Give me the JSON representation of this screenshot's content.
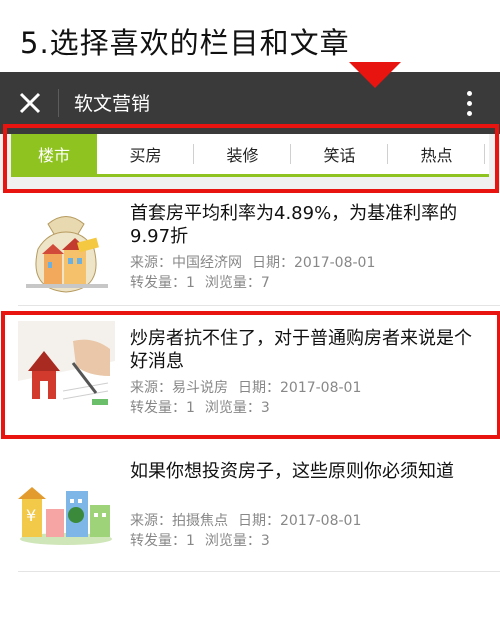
{
  "banner": {
    "title": "5.选择喜欢的栏目和文章"
  },
  "app": {
    "title": "软文营销"
  },
  "tabs": [
    {
      "label": "楼市",
      "active": true
    },
    {
      "label": "买房",
      "active": false
    },
    {
      "label": "装修",
      "active": false
    },
    {
      "label": "笑话",
      "active": false
    },
    {
      "label": "热点",
      "active": false
    }
  ],
  "articles": [
    {
      "title": "首套房平均利率为4.89%，为基准利率的9.97折",
      "source_label": "来源：中国经济网",
      "date_label": "日期：2017-08-01",
      "shares_label": "转发量：1",
      "views_label": "浏览量：7"
    },
    {
      "title": "炒房者抗不住了，对于普通购房者来说是个好消息",
      "source_label": "来源：易斗说房",
      "date_label": "日期：2017-08-01",
      "shares_label": "转发量：1",
      "views_label": "浏览量：3"
    },
    {
      "title": "如果你想投资房子，这些原则你必须知道",
      "source_label": "来源：拍摄焦点",
      "date_label": "日期：2017-08-01",
      "shares_label": "转发量：1",
      "views_label": "浏览量：3"
    }
  ],
  "colors": {
    "accent_green": "#8fc31f",
    "highlight_red": "#e8140f",
    "titlebar": "#3a3a3a"
  },
  "icons": {
    "close": "close-icon",
    "more": "more-vertical-icon"
  }
}
